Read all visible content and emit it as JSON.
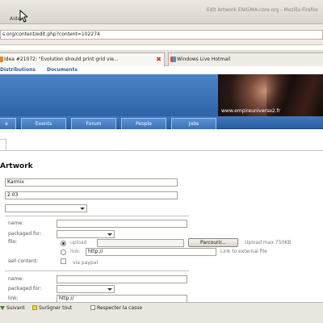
{
  "window": {
    "title": "Edit Artwork ENIGMA-core.org - Mozilla Firefox",
    "menu_fragment": "Aide"
  },
  "address_bar": {
    "url": "s.org/content/edit.php?content=102274"
  },
  "tabs": [
    {
      "label": "Idea #21072: \"Evolution should print grid vie...",
      "active": true
    },
    {
      "label": "Windows Live Hotmail",
      "active": false
    }
  ],
  "site_nav": {
    "items": [
      "Distributions",
      "Documents"
    ]
  },
  "banner": {
    "credit": "www.empireuniverse2.fr"
  },
  "main_nav": {
    "items": [
      "e",
      "Events",
      "Forum",
      "People",
      "Jobs"
    ]
  },
  "form": {
    "heading": "Artwork",
    "title_value": "Karmix",
    "version_value": "2.03",
    "category_value": "",
    "file_block_1": {
      "name_label": "name:",
      "name_value": "",
      "packaged_label": "packaged for:",
      "packaged_value": "",
      "file_label": "file:",
      "upload_label": "upload",
      "browse_label": "Parcourir...",
      "upload_max": "Upload max 750KB",
      "link_label": "link:",
      "link_value": "http://",
      "link_external": "Link to external file",
      "sell_label": "sell content:",
      "paypal_label": "via paypal",
      "upload_selected": true
    },
    "file_block_2": {
      "name_label": "name:",
      "name_value": "",
      "packaged_label": "packaged for:",
      "packaged_value": "",
      "link_label": "link:",
      "link_value": "http://"
    }
  },
  "find_bar": {
    "next_label": "Suivant",
    "highlight_label": "Surligner tout",
    "match_case_label": "Respecter la casse"
  },
  "colors": {
    "nav_blue": "#2f63a8",
    "link_blue": "#2c5f9c",
    "close_red": "#d03a2a"
  }
}
